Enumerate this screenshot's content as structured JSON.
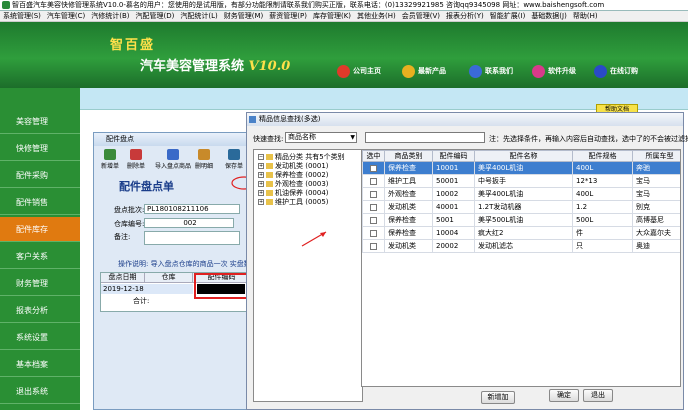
{
  "titlebar": {
    "text": "智百盛汽车美容快修管理系统V10.0-慕名的用户：您使用的是试用版，有部分功能限制请联系我们购买正版，联系电话：(0)13329921985 咨询qq9345098 网址：www.baishengsoft.com"
  },
  "menubar": {
    "items": [
      "系统管理(S)",
      "汽车管理(C)",
      "汽修统计(B)",
      "汽配管理(D)",
      "汽配统计(L)",
      "财务管理(M)",
      "薪资管理(P)",
      "库存管理(K)",
      "其他业务(H)",
      "会员管理(V)",
      "报表分析(Y)",
      "智能扩展(I)",
      "基础数据(J)",
      "帮助(H)"
    ]
  },
  "banner": {
    "logo": "智百盛",
    "title": "汽车美容管理系统",
    "version": "V10.0"
  },
  "topnav": [
    {
      "label": "公司主页",
      "color": "#e03a2a"
    },
    {
      "label": "最新产品",
      "color": "#e8b020"
    },
    {
      "label": "联系我们",
      "color": "#3a6ad8"
    },
    {
      "label": "软件升级",
      "color": "#d83a8a"
    },
    {
      "label": "在线订购",
      "color": "#2a4ac8"
    }
  ],
  "sidebar": {
    "items": [
      {
        "label": "美容管理",
        "active": false
      },
      {
        "label": "快修管理",
        "active": false
      },
      {
        "label": "配件采购",
        "active": false
      },
      {
        "label": "配件销售",
        "active": false
      },
      {
        "label": "配件库存",
        "active": true
      },
      {
        "label": "客户关系",
        "active": false
      },
      {
        "label": "财务管理",
        "active": false
      },
      {
        "label": "报表分析",
        "active": false
      },
      {
        "label": "系统设置",
        "active": false
      },
      {
        "label": "基本档案",
        "active": false
      },
      {
        "label": "退出系统",
        "active": false
      }
    ]
  },
  "content": {
    "yellow_button": "帮助文档"
  },
  "win1": {
    "title": "配件盘点",
    "toolbar": [
      "新增单",
      "删除单",
      "导入盘点商品",
      "删明细",
      "保存单"
    ],
    "heading": "配件盘点单",
    "fields": {
      "batch_label": "盘点批次:",
      "batch_value": "PL180108211106",
      "warehouse_label": "仓库编号:",
      "warehouse_value": "002",
      "remark_label": "备注:"
    },
    "note": "操作说明: 导入盘点仓库的商品一次 实盘数量",
    "grid": {
      "headers": [
        "盘点日期",
        "仓库",
        "配件编码"
      ],
      "row_date": "2019-12-18",
      "total_label": "合计:"
    }
  },
  "dialog": {
    "title": "精品信息查找(多选)",
    "quickfind_label": "快速查找:",
    "quickfind_value": "商品名称",
    "note": "注：先选择条件，再输入内容后自动查找，选中了的不会被过滤掉！",
    "tree": [
      {
        "label": "精品分类 共有5个类别",
        "level": 0
      },
      {
        "label": "发动机类 (0001)",
        "level": 1
      },
      {
        "label": "保养检查 (0002)",
        "level": 1
      },
      {
        "label": "外观检查 (0003)",
        "level": 1
      },
      {
        "label": "机油保养 (0004)",
        "level": 1
      },
      {
        "label": "维护工具 (0005)",
        "level": 1
      }
    ],
    "grid": {
      "headers": [
        "选中",
        "商品类别",
        "配件编码",
        "配件名称",
        "配件规格",
        "所属车型"
      ],
      "rows": [
        [
          "",
          "保养检查",
          "10001",
          "美孚400L机油",
          "400L",
          "奔驰"
        ],
        [
          "",
          "维护工具",
          "50001",
          "中号扳手",
          "12*13",
          "宝马"
        ],
        [
          "",
          "外观检查",
          "10002",
          "美孚400L机油",
          "400L",
          "宝马"
        ],
        [
          "",
          "发动机类",
          "40001",
          "1.2T发动机器",
          "1.2",
          "别克"
        ],
        [
          "",
          "保养检查",
          "5001",
          "美孚500L机油",
          "500L",
          "高博基尼"
        ],
        [
          "",
          "保养检查",
          "10004",
          "疯大红2",
          "件",
          "大众嘉尔夫"
        ],
        [
          "",
          "发动机类",
          "20002",
          "发动机滤芯",
          "只",
          "奥迪"
        ]
      ],
      "selected_row": 0
    },
    "buttons": {
      "add": "新增加",
      "ok": "确定",
      "exit": "退出"
    }
  }
}
